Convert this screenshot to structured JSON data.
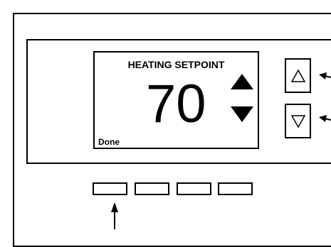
{
  "display": {
    "title": "HEATING SETPOINT",
    "setpoint_value": "70",
    "done_label": "Done"
  },
  "buttons": {
    "up_icon": "triangle-up-outline-icon",
    "down_icon": "triangle-down-outline-icon"
  },
  "soft_keys": {
    "count": 4
  },
  "callout_arrows": [
    "up-button-pointer",
    "down-button-pointer",
    "soft-key-pointer"
  ],
  "colors": {
    "line": "#000000",
    "background": "#ffffff"
  }
}
